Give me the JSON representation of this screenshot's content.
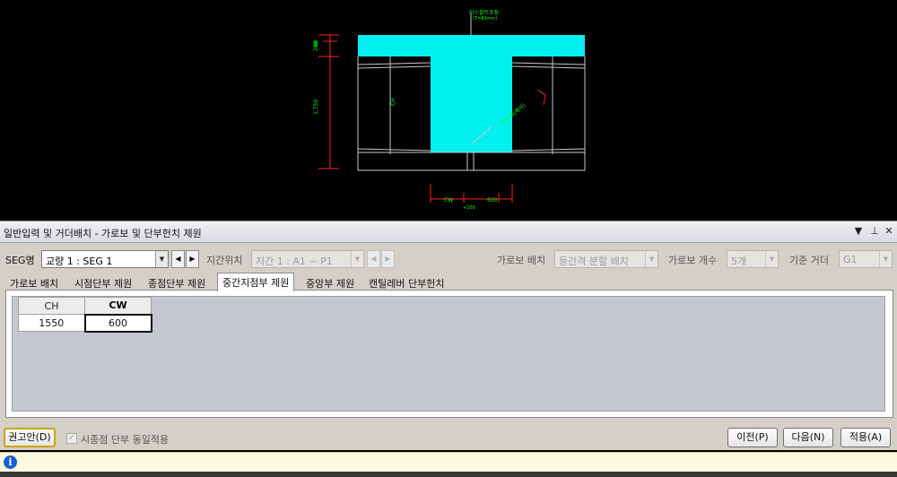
{
  "cad": {
    "dims_left": [
      "80",
      "200",
      "1,750"
    ],
    "label_top": "아스팔트포장",
    "label_top_sub": "(T=80mm)",
    "label_slope": "경사 폭(해석)",
    "label_web": "CH",
    "dims_bottom": [
      "CW",
      "600"
    ],
    "dims_bottom_sub": "+100",
    "colors": {
      "section": "#00f0f0",
      "dim": "#ff2020",
      "text": "#00ff00",
      "line": "#e0e0e0"
    }
  },
  "panel": {
    "title": "일반입력 및 거더배치 - 가로보 및 단부헌치 제원",
    "ctrl_dropdown": "▼",
    "ctrl_pin": "ᅟ",
    "ctrl_close": "✕"
  },
  "toprow": {
    "seg_label": "SEG명",
    "seg_value": "교량 1 : SEG 1",
    "prev": "◀",
    "next": "▶",
    "span_label": "지간위치",
    "span_value": "지간 1 : A1 ~ P1",
    "crossbeam_label": "가로보 배치",
    "crossbeam_value": "등간격 분할 배치",
    "count_label": "가로보 개수",
    "count_value": "5개",
    "girder_label": "기준 거더",
    "girder_value": "G1"
  },
  "tabs": [
    {
      "label": "가로보 배치"
    },
    {
      "label": "시점단부 제원"
    },
    {
      "label": "종점단부 제원"
    },
    {
      "label": "중간지점부 제원"
    },
    {
      "label": "중앙부 제원"
    },
    {
      "label": "캔틸레버 단부헌치"
    }
  ],
  "grid": {
    "headers": [
      "CH",
      "CW"
    ],
    "row": [
      "1550",
      "600"
    ]
  },
  "bottom": {
    "recommend": "권고안(D)",
    "same_apply": "시종점 단부 동일적용",
    "check_mark": "✓",
    "prev": "이전(P)",
    "next": "다음(N)",
    "apply": "적용(A)"
  },
  "status": {
    "icon": "i"
  }
}
